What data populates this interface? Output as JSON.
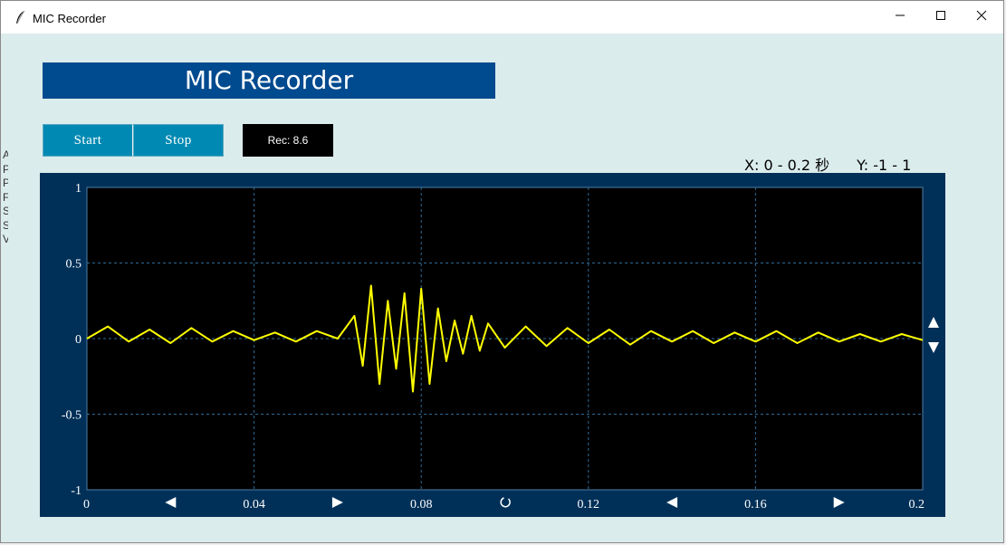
{
  "window": {
    "title": "MIC Recorder",
    "controls": [
      "minimize",
      "maximize",
      "close"
    ],
    "app_icon": "feather-icon"
  },
  "left_clipped_chars": [
    "A",
    "P",
    "P",
    "F",
    "S",
    "S",
    "V"
  ],
  "header": {
    "title": "MIC Recorder"
  },
  "toolbar": {
    "start_label": "Start",
    "stop_label": "Stop",
    "rec_label": "Rec: 8.6"
  },
  "range": {
    "x_text": "X: 0 - 0.2 秒",
    "y_text": "Y: -1 - 1"
  },
  "colors": {
    "header_bg": "#004a8f",
    "button_bg": "#008ab3",
    "scope_frame": "#003058",
    "plot_bg": "#000000",
    "trace": "#ffff00",
    "grid": "#2f6a96"
  },
  "icons": {
    "x_left_1": "left-arrow-icon",
    "x_right_1": "right-arrow-icon",
    "x_reset": "reset-icon",
    "x_left_2": "left-arrow-icon",
    "x_right_2": "right-arrow-icon",
    "y_up": "up-arrow-icon",
    "y_down": "down-arrow-icon"
  },
  "chart_data": {
    "type": "line",
    "title": "",
    "xlabel": "",
    "ylabel": "",
    "xlim": [
      0,
      0.2
    ],
    "ylim": [
      -1,
      1
    ],
    "grid": true,
    "x_tick_labels": [
      "0",
      "0.04",
      "0.08",
      "0.12",
      "0.16",
      "0.2"
    ],
    "y_tick_labels": [
      "1",
      "0.5",
      "0",
      "-0.5",
      "-1"
    ],
    "series": [
      {
        "color": "#ffff00",
        "x": [
          0,
          0.005,
          0.01,
          0.015,
          0.02,
          0.025,
          0.03,
          0.035,
          0.04,
          0.045,
          0.05,
          0.055,
          0.06,
          0.064,
          0.066,
          0.068,
          0.07,
          0.072,
          0.074,
          0.076,
          0.078,
          0.08,
          0.082,
          0.084,
          0.086,
          0.088,
          0.09,
          0.092,
          0.094,
          0.096,
          0.1,
          0.105,
          0.11,
          0.115,
          0.12,
          0.125,
          0.13,
          0.135,
          0.14,
          0.145,
          0.15,
          0.155,
          0.16,
          0.165,
          0.17,
          0.175,
          0.18,
          0.185,
          0.19,
          0.195,
          0.2
        ],
        "y": [
          0.0,
          0.08,
          -0.02,
          0.06,
          -0.03,
          0.07,
          -0.02,
          0.05,
          -0.01,
          0.04,
          -0.02,
          0.05,
          0.0,
          0.15,
          -0.18,
          0.35,
          -0.3,
          0.25,
          -0.2,
          0.3,
          -0.35,
          0.33,
          -0.3,
          0.2,
          -0.15,
          0.12,
          -0.1,
          0.15,
          -0.08,
          0.1,
          -0.06,
          0.08,
          -0.05,
          0.07,
          -0.03,
          0.06,
          -0.04,
          0.05,
          -0.02,
          0.05,
          -0.03,
          0.04,
          -0.02,
          0.05,
          -0.03,
          0.04,
          -0.02,
          0.03,
          -0.02,
          0.03,
          -0.01
        ]
      }
    ]
  }
}
